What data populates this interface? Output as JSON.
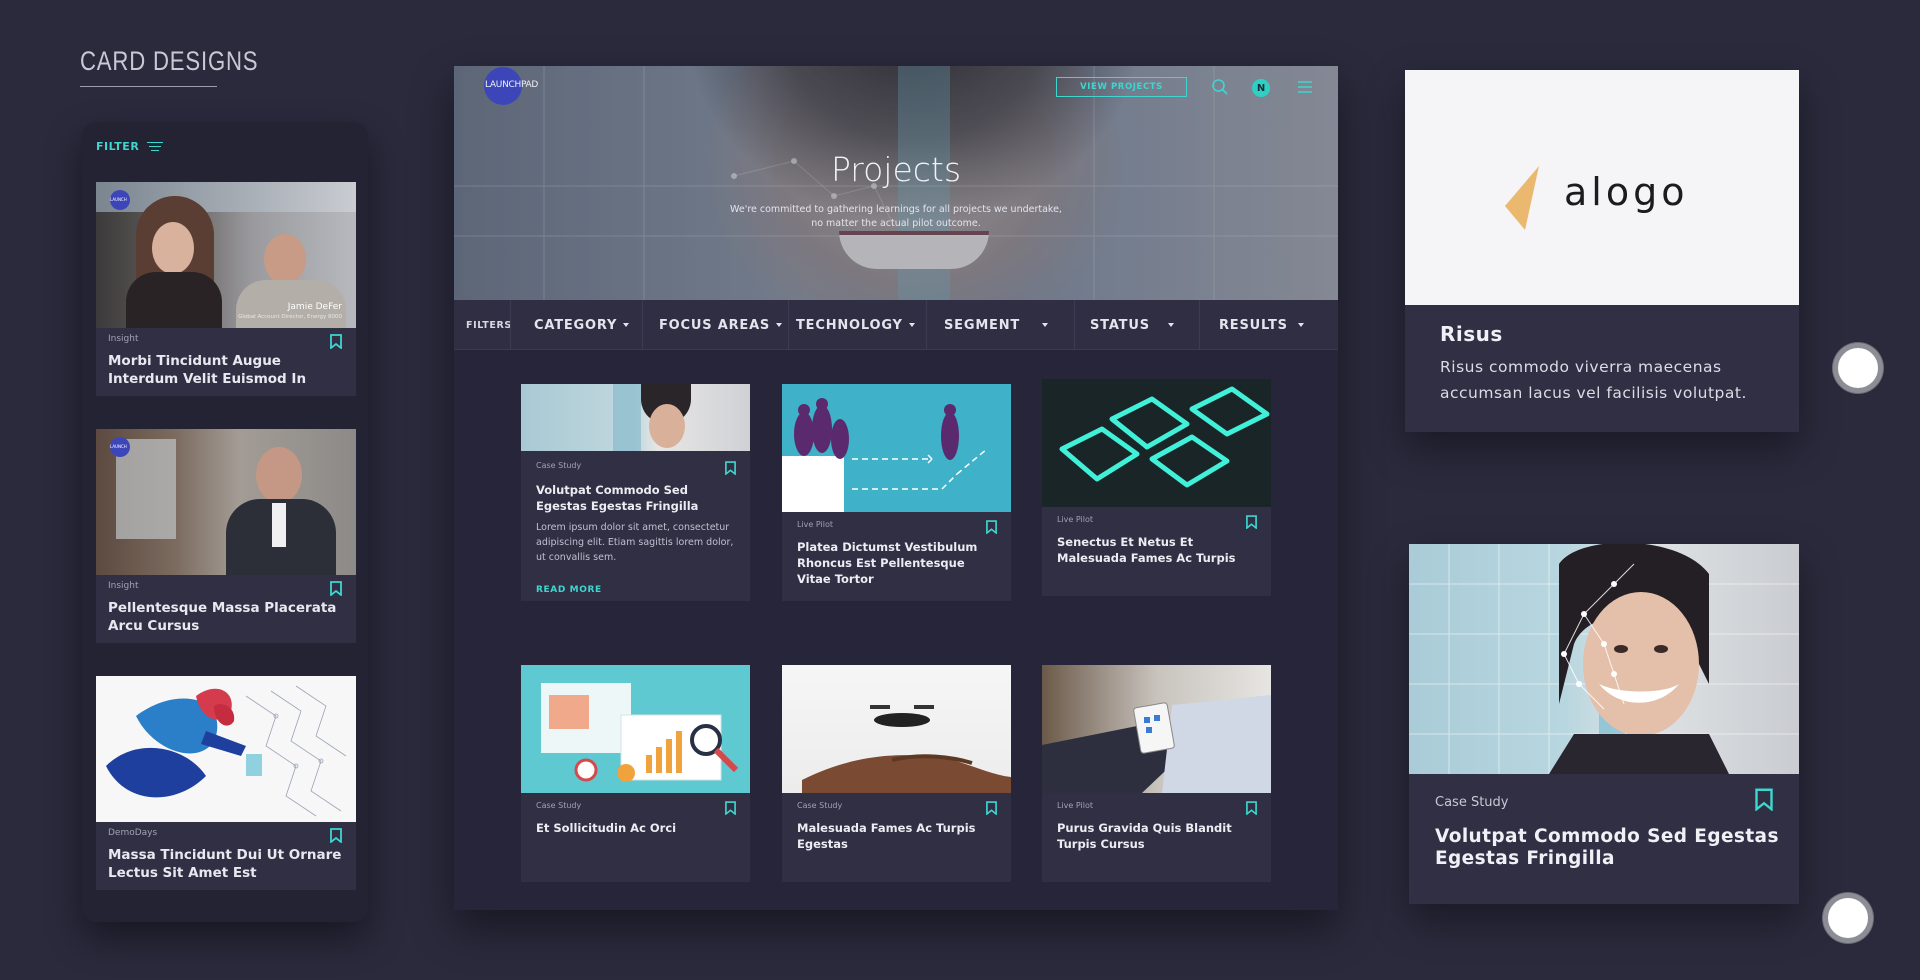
{
  "page": {
    "title": "CARD DESIGNS"
  },
  "colors": {
    "background": "#2b2a3d",
    "accent": "#3ed6cf",
    "card": "#302f43",
    "logo": "#3d46b8"
  },
  "mobile": {
    "filter_label": "FILTER",
    "cards": [
      {
        "tag": "Insight",
        "title": "Morbi Tincidunt Augue Interdum Velit Euismod In",
        "caption_name": "Jamie DeFer",
        "caption_role": "Global Account Director, Energy 8000",
        "badge": "LAUNCH"
      },
      {
        "tag": "Insight",
        "title": "Pellentesque Massa Placerata Arcu Cursus",
        "badge": "LAUNCH"
      },
      {
        "tag": "DemoDays",
        "title": "Massa Tincidunt Dui Ut Ornare Lectus Sit Amet Est"
      }
    ]
  },
  "desktop": {
    "logo": "LAUNCHPAD",
    "view_projects": "VIEW PROJECTS",
    "avatar_initial": "N",
    "hero_title": "Projects",
    "hero_sub_1": "We're committed to gathering learnings for all projects we undertake,",
    "hero_sub_2": "no matter the actual pilot outcome.",
    "filters_label": "FILTERS",
    "filters": [
      "CATEGORY",
      "FOCUS AREAS",
      "TECHNOLOGY",
      "SEGMENT",
      "STATUS",
      "RESULTS"
    ],
    "cards": [
      {
        "tag": "Case Study",
        "title": "Volutpat Commodo Sed Egestas Egestas Fringilla",
        "desc": "Lorem ipsum dolor sit amet, consectetur adipiscing elit. Etiam sagittis lorem dolor, ut convallis sem.",
        "read_more": "READ MORE"
      },
      {
        "tag": "Live Pilot",
        "title": "Platea Dictumst Vestibulum Rhoncus Est Pellentesque Vitae Tortor"
      },
      {
        "tag": "Live Pilot",
        "title": "Senectus Et Netus Et Malesuada Fames Ac Turpis"
      },
      {
        "tag": "Case Study",
        "title": "Et Sollicitudin Ac Orci"
      },
      {
        "tag": "Case Study",
        "title": "Malesuada Fames Ac Turpis Egestas"
      },
      {
        "tag": "Live Pilot",
        "title": "Purus Gravida Quis Blandit Turpis Cursus"
      }
    ]
  },
  "right": {
    "logo_text": "alogo",
    "card1_title": "Risus",
    "card1_desc": "Risus commodo viverra maecenas accumsan lacus vel facilisis volutpat.",
    "card2_tag": "Case Study",
    "card2_title": "Volutpat Commodo Sed Egestas Egestas Fringilla"
  }
}
